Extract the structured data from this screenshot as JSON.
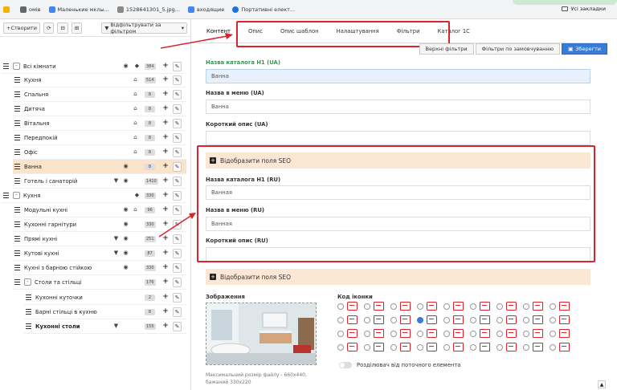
{
  "bookmarks": {
    "items": [
      {
        "label": "",
        "color": "#f4b400"
      },
      {
        "label": "омів",
        "color": "#555"
      },
      {
        "label": "Маленькие мклы...",
        "color": "#4285f4"
      },
      {
        "label": "1528641301_5.jpg...",
        "color": "#777"
      },
      {
        "label": "входящие",
        "color": "#4285f4"
      },
      {
        "label": "Портативні елект...",
        "color": "#1a73e8"
      }
    ],
    "all_bookmarks": "Усі закладки"
  },
  "left_toolbar": {
    "create": "+Створити",
    "filter": "Відфільтрувати за фільтром"
  },
  "tree": [
    {
      "label": "Всі кімнати",
      "count": "384",
      "bold": false,
      "selected": false
    },
    {
      "label": "Кухня",
      "count": "514",
      "bold": false,
      "selected": false
    },
    {
      "label": "Спальня",
      "count": "8",
      "bold": false,
      "selected": false
    },
    {
      "label": "Дитяча",
      "count": "8",
      "bold": false,
      "selected": false
    },
    {
      "label": "Вітальня",
      "count": "8",
      "bold": false,
      "selected": false
    },
    {
      "label": "Передпокій",
      "count": "8",
      "bold": false,
      "selected": false
    },
    {
      "label": "Офіс",
      "count": "8",
      "bold": false,
      "selected": false
    },
    {
      "label": "Ванна",
      "count": "8",
      "bold": false,
      "selected": true
    },
    {
      "label": "Готель і санаторій",
      "count": "1410",
      "bold": false,
      "selected": false
    },
    {
      "label": "Кухня",
      "count": "330",
      "bold": false,
      "selected": false
    },
    {
      "label": "Модульні кухні",
      "count": "96",
      "bold": false,
      "selected": false
    },
    {
      "label": "Кухонні гарнітури",
      "count": "330",
      "bold": false,
      "selected": false
    },
    {
      "label": "Прямі кухні",
      "count": "251",
      "bold": false,
      "selected": false
    },
    {
      "label": "Кутові кухні",
      "count": "87",
      "bold": false,
      "selected": false
    },
    {
      "label": "Кухні з барною стійкою",
      "count": "330",
      "bold": false,
      "selected": false
    },
    {
      "label": "Столи та стільці",
      "count": "176",
      "bold": false,
      "selected": false
    },
    {
      "label": "Кухонні куточки",
      "count": "2",
      "bold": false,
      "selected": false
    },
    {
      "label": "Барні стільці в кухню",
      "count": "8",
      "bold": false,
      "selected": false
    },
    {
      "label": "Кухонні столи",
      "count": "155",
      "bold": true,
      "selected": false
    }
  ],
  "tabs": [
    {
      "label": "Контент"
    },
    {
      "label": "Опис"
    },
    {
      "label": "Опис шаблон"
    },
    {
      "label": "Налаштування"
    },
    {
      "label": "Фільтри"
    },
    {
      "label": "Каталог 1С"
    }
  ],
  "actions": {
    "top_filters": "Верхні фільтри",
    "default_filters": "Фільтри по замовчуванню",
    "save": "Зберегти"
  },
  "fields": {
    "name_h1_ua_label": "Назва каталога Н1 (UA)",
    "name_h1_ua_value": "Ванна",
    "menu_ua_label": "Назва в меню (UA)",
    "menu_ua_value": "Ванна",
    "short_ua_label": "Короткий опис (UA)",
    "seo_toggle_1": "Відобразити поля SEO",
    "name_h1_ru_label": "Назва каталога Н1 (RU)",
    "name_h1_ru_value": "Ванная",
    "menu_ru_label": "Назва в меню (RU)",
    "menu_ru_value": "Ванная",
    "short_ru_label": "Короткий опис (RU)",
    "seo_toggle_2": "Відобразити поля SEO",
    "image_label": "Зображення",
    "icon_code_label": "Код іконки",
    "max_size_line1": "Максимальний розмір файлу - 660х440,",
    "max_size_line2": "бажаний 330х220",
    "separator_toggle": "Розділювач від поточного елемента"
  },
  "colors": {
    "accent_red": "#d9232d",
    "save_blue": "#3a7bd5",
    "selected_row": "#fbe3c9",
    "seo_bg": "#fbe7d3"
  }
}
